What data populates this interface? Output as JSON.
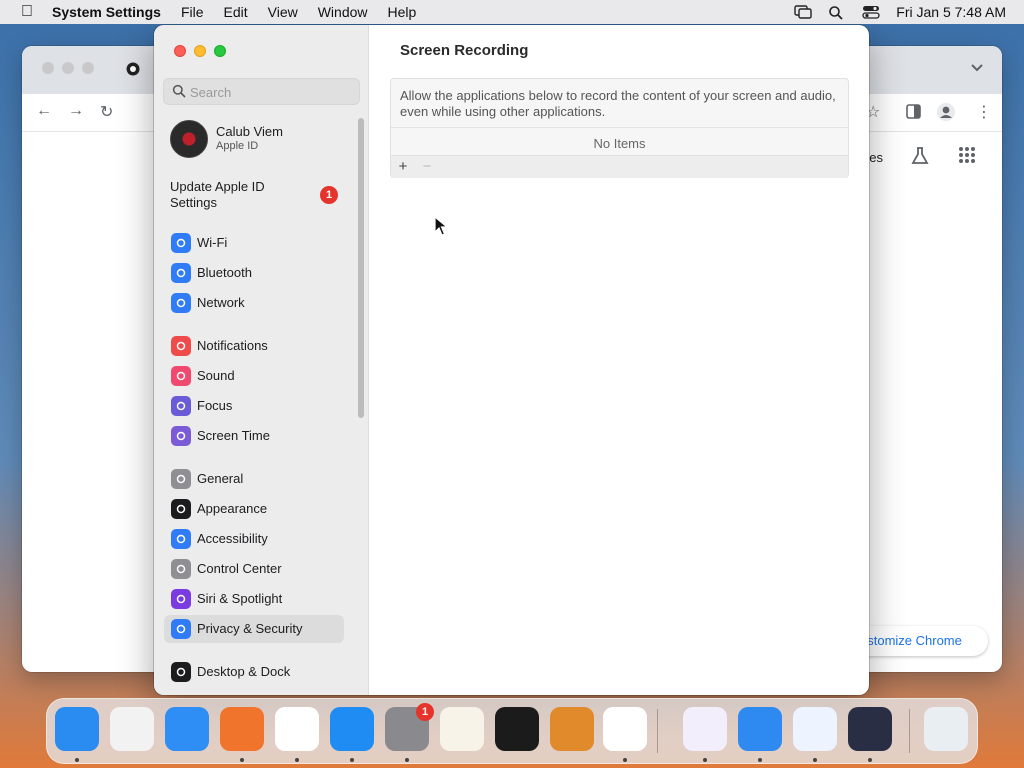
{
  "menubar": {
    "app_name": "System Settings",
    "menus": [
      "File",
      "Edit",
      "View",
      "Window",
      "Help"
    ],
    "clock": "Fri Jan 5  7:48 AM"
  },
  "chrome": {
    "partial_text": "ges",
    "customize_label": "ustomize Chrome"
  },
  "settings": {
    "search_placeholder": "Search",
    "account": {
      "name": "Calub Viem",
      "subtitle": "Apple ID"
    },
    "update": {
      "label": "Update Apple ID Settings",
      "badge": "1"
    },
    "sidebar_items": [
      {
        "label": "Wi-Fi",
        "color": "#2f7cf6",
        "icon": "wifi-icon"
      },
      {
        "label": "Bluetooth",
        "color": "#2f7cf6",
        "icon": "bluetooth-icon"
      },
      {
        "label": "Network",
        "color": "#2f7cf6",
        "icon": "globe-icon"
      },
      {
        "label": "Notifications",
        "color": "#f04b4b",
        "icon": "bell-icon"
      },
      {
        "label": "Sound",
        "color": "#f0486e",
        "icon": "speaker-icon"
      },
      {
        "label": "Focus",
        "color": "#6a5bd6",
        "icon": "moon-icon"
      },
      {
        "label": "Screen Time",
        "color": "#7b5bd6",
        "icon": "hourglass-icon"
      },
      {
        "label": "General",
        "color": "#8e8e93",
        "icon": "gear-icon"
      },
      {
        "label": "Appearance",
        "color": "#1c1c1e",
        "icon": "appearance-icon"
      },
      {
        "label": "Accessibility",
        "color": "#2f7cf6",
        "icon": "accessibility-icon"
      },
      {
        "label": "Control Center",
        "color": "#8e8e93",
        "icon": "toggles-icon"
      },
      {
        "label": "Siri & Spotlight",
        "color": "#7a3be0",
        "icon": "siri-icon"
      },
      {
        "label": "Privacy & Security",
        "color": "#2f7cf6",
        "icon": "hand-icon"
      },
      {
        "label": "Desktop & Dock",
        "color": "#1c1c1e",
        "icon": "dock-icon"
      }
    ],
    "selected_item": "Privacy & Security",
    "main": {
      "title": "Screen Recording",
      "description": "Allow the applications below to record the content of your screen and audio, even while using other applications.",
      "empty_text": "No Items",
      "add_label": "+",
      "remove_label": "−"
    }
  },
  "dock": {
    "badge": "1",
    "apps": [
      {
        "name": "Finder",
        "icon": "finder-icon",
        "color": "#2a8cf0",
        "running": true
      },
      {
        "name": "Launchpad",
        "icon": "launchpad-icon",
        "color": "#f2f2f2",
        "running": false
      },
      {
        "name": "Safari",
        "icon": "safari-icon",
        "color": "#2e8ef5",
        "running": false
      },
      {
        "name": "Firefox",
        "icon": "firefox-icon",
        "color": "#f0742c",
        "running": true
      },
      {
        "name": "Chrome",
        "icon": "chrome-icon",
        "color": "#ffffff",
        "running": true
      },
      {
        "name": "App Store",
        "icon": "appstore-icon",
        "color": "#1e8cf2",
        "running": true
      },
      {
        "name": "System Settings",
        "icon": "settings-icon",
        "color": "#8a8a8e",
        "running": true
      },
      {
        "name": "TextEdit",
        "icon": "textedit-icon",
        "color": "#f7f3e8",
        "running": false
      },
      {
        "name": "Terminal",
        "icon": "terminal-icon",
        "color": "#1b1b1b",
        "running": false
      },
      {
        "name": "GarageBand",
        "icon": "garageband-icon",
        "color": "#e08a2c",
        "running": false
      },
      {
        "name": "VS Code",
        "icon": "vscode-icon",
        "color": "#ffffff",
        "running": true
      },
      {
        "name": "Visual Studio",
        "icon": "visualstudio-icon",
        "color": "#f3eefb",
        "running": true
      },
      {
        "name": "Weather",
        "icon": "weather-icon",
        "color": "#2e8af0",
        "running": true
      },
      {
        "name": "Freeform",
        "icon": "freeform-icon",
        "color": "#eef4ff",
        "running": true
      },
      {
        "name": "OBS",
        "icon": "obs-icon",
        "color": "#2a2e45",
        "running": true
      },
      {
        "name": "Trash",
        "icon": "trash-icon",
        "color": "#e9eef3",
        "running": false
      }
    ]
  }
}
